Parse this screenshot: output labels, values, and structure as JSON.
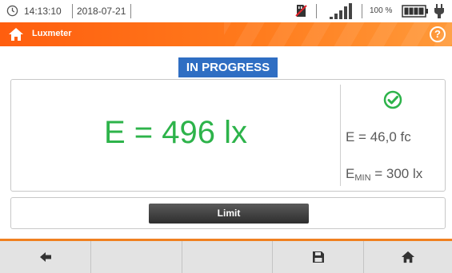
{
  "status": {
    "time": "14:13:10",
    "date": "2018-07-21",
    "battery": "100 %",
    "icons": [
      "clock-icon",
      "sd-card-icon",
      "signal-icon",
      "battery-icon",
      "plug-icon"
    ]
  },
  "titlebar": {
    "title": "Luxmeter",
    "help": "?",
    "icons": [
      "home-icon",
      "help-icon"
    ]
  },
  "state_badge": "IN PROGRESS",
  "measurement": {
    "main": "E = 496 lx",
    "fc": "E = 46,0 fc",
    "emin_prefix": "E",
    "emin_sub": "MIN",
    "emin_value": " = 300 lx",
    "status_icon": "check-circle-icon"
  },
  "limit_button": "Limit",
  "toolbar": {
    "buttons": [
      "back-icon",
      "",
      "",
      "save-icon",
      "home-icon"
    ]
  },
  "colors": {
    "accent": "#ff6a16",
    "badge": "#2f6ec3",
    "reading": "#2db34a",
    "toolbar": "#e3e3e3"
  }
}
